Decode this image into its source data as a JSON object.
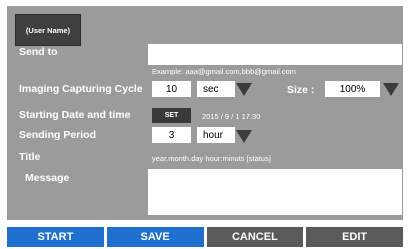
{
  "user_tab": "(User Name)",
  "send_to": {
    "label": "Send to",
    "value": "",
    "example": "Example:  aaa@gmail.com,bbb@gmail.com"
  },
  "imaging_cycle": {
    "label": "Imaging Capturing Cycle",
    "value": "10",
    "unit": "sec"
  },
  "size": {
    "label": "Size :",
    "value": "100%"
  },
  "starting": {
    "label": "Starting Date and time",
    "set_button": "SET",
    "datetime": "2015 / 9 / 1   17:30"
  },
  "sending_period": {
    "label": "Sending Period",
    "value": "3",
    "unit": "hour"
  },
  "title": {
    "label": "Title",
    "format": "year.month.day hour:minuts   [status]"
  },
  "message": {
    "label": "Message",
    "value": ""
  },
  "buttons": {
    "start": "START",
    "save": "SAVE",
    "cancel": "CANCEL",
    "edit": "EDIT"
  },
  "colors": {
    "panel": "#9b9b9b",
    "blue": "#1f6fd0",
    "gray": "#5a5a5a"
  }
}
